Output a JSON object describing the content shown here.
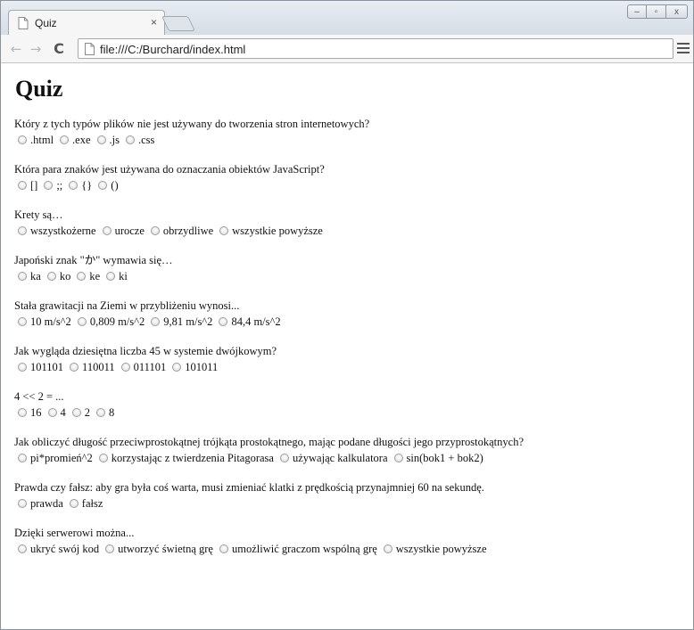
{
  "browser": {
    "tab_title": "Quiz",
    "tab_close": "×",
    "url": "file:///C:/Burchard/index.html",
    "window_controls": {
      "minimize": "–",
      "maximize": "▫",
      "close": "x"
    }
  },
  "page": {
    "title": "Quiz",
    "questions": [
      {
        "text": "Który z tych typów plików nie jest używany do tworzenia stron internetowych?",
        "answers": [
          ".html",
          ".exe",
          ".js",
          ".css"
        ]
      },
      {
        "text": "Która para znaków jest używana do oznaczania obiektów JavaScript?",
        "answers": [
          "[]",
          ";;",
          "{}",
          "()"
        ]
      },
      {
        "text": "Krety są…",
        "answers": [
          "wszystkożerne",
          "urocze",
          "obrzydliwe",
          "wszystkie powyższe"
        ]
      },
      {
        "text": "Japoński znak \"か\" wymawia się…",
        "answers": [
          "ka",
          "ko",
          "ke",
          "ki"
        ]
      },
      {
        "text": "Stała grawitacji na Ziemi w przybliżeniu wynosi...",
        "answers": [
          "10 m/s^2",
          "0,809 m/s^2",
          "9,81 m/s^2",
          "84,4 m/s^2"
        ]
      },
      {
        "text": "Jak wygląda dziesiętna liczba 45 w systemie dwójkowym?",
        "answers": [
          "101101",
          "110011",
          "011101",
          "101011"
        ]
      },
      {
        "text": "4 << 2 = ...",
        "answers": [
          "16",
          "4",
          "2",
          "8"
        ]
      },
      {
        "text": "Jak obliczyć długość przeciwprostokątnej trójkąta prostokątnego, mając podane długości jego przyprostokątnych?",
        "answers": [
          "pi*promień^2",
          "korzystając z twierdzenia Pitagorasa",
          "używając kalkulatora",
          "sin(bok1 + bok2)"
        ]
      },
      {
        "text": "Prawda czy fałsz: aby gra była coś warta, musi zmieniać klatki z prędkością przynajmniej 60 na sekundę.",
        "answers": [
          "prawda",
          "fałsz"
        ]
      },
      {
        "text": "Dzięki serwerowi można...",
        "answers": [
          "ukryć swój kod",
          "utworzyć świetną grę",
          "umożliwić graczom wspólną grę",
          "wszystkie powyższe"
        ]
      }
    ]
  }
}
